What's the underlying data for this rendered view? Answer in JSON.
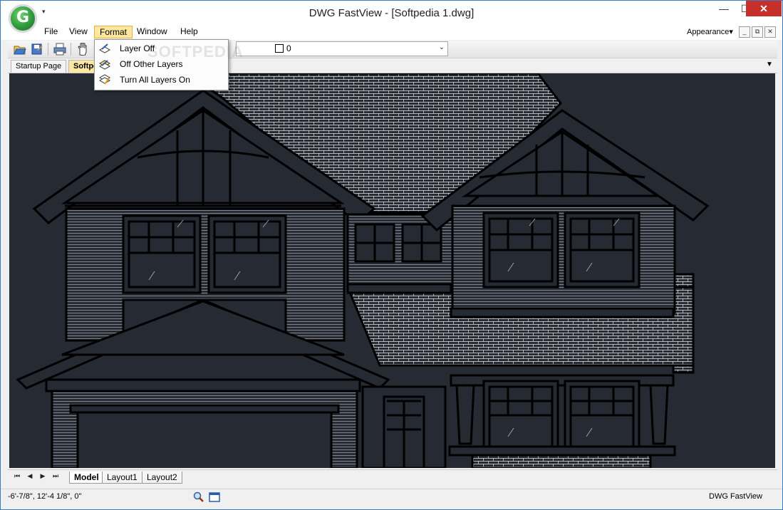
{
  "window": {
    "title": "DWG FastView - [Softpedia 1.dwg]",
    "qat_arrow": "▾",
    "caption": {
      "minimize": "—",
      "maximize": "☐",
      "close": "✕"
    }
  },
  "menu": {
    "file": "File",
    "view": "View",
    "format": "Format",
    "window": "Window",
    "help": "Help",
    "appearance": "Appearance▾"
  },
  "mdi": {
    "minimize": "_",
    "restore": "⧉",
    "close": "✕"
  },
  "toolbar": {
    "icons": [
      "open-icon",
      "save-icon",
      "print-icon",
      "pan-icon",
      "bulb-icon",
      "sun-icon",
      "lock-icon",
      "color-square-icon"
    ],
    "layer_value": "0"
  },
  "format_menu": {
    "items": [
      "Layer Off",
      "Off Other Layers",
      "Turn All Layers On"
    ],
    "watermark": "SOFTPEDIA"
  },
  "tabs": {
    "startup": "Startup Page",
    "softpedia": "Softpe",
    "list_arrow": "▼"
  },
  "layout_tabs": {
    "nav": [
      "⏮",
      "◀",
      "▶",
      "⏭"
    ],
    "model": "Model",
    "layout1": "Layout1",
    "layout2": "Layout2"
  },
  "status": {
    "coords": "-6'-7/8\", 12'-4 1/8\", 0\"",
    "app": "DWG FastView"
  },
  "colors": {
    "canvas_bg": "#262a33",
    "drawing_line": "#000000",
    "roof_hatch": "#ffffff",
    "menu_highlight": "#fde6a0",
    "close_button": "#c7302a"
  }
}
